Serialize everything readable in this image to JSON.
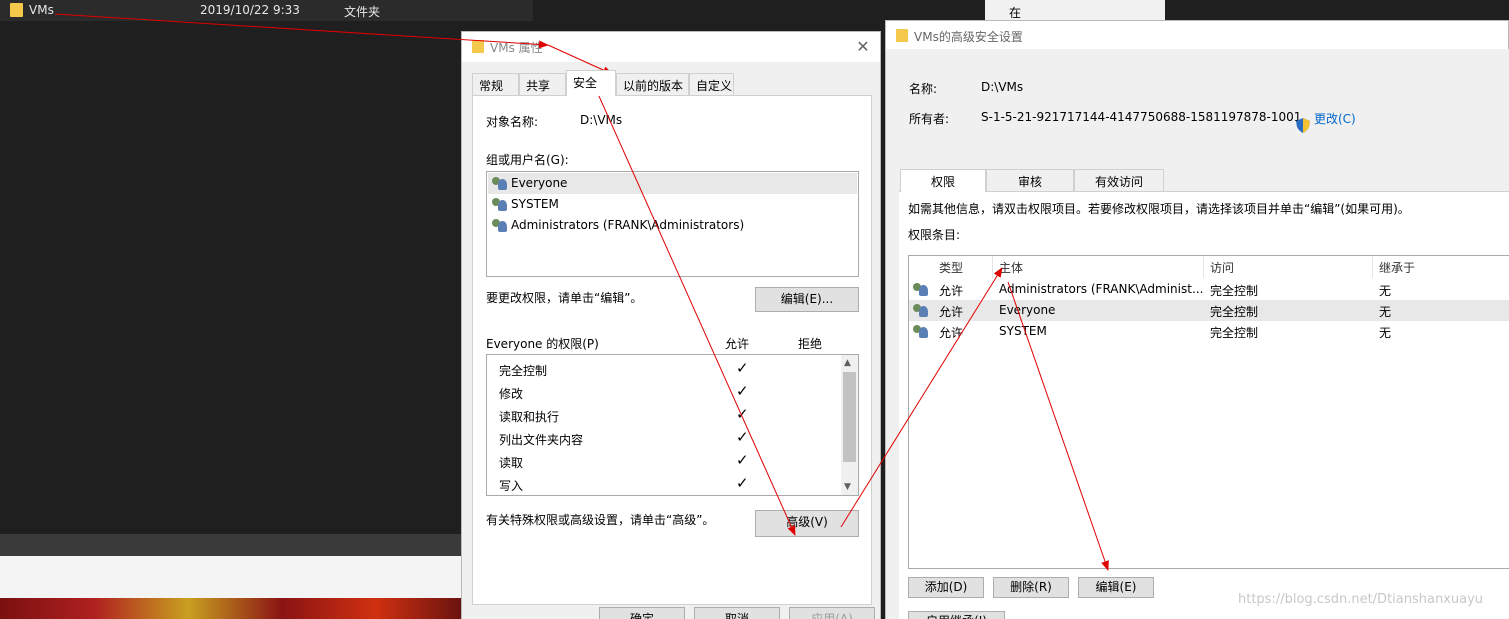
{
  "explorer": {
    "file_name": "VMs",
    "file_date": "2019/10/22 9:33",
    "file_type": "文件夹",
    "right_fragment": "在"
  },
  "properties_dialog": {
    "title": "VMs 属性",
    "tabs": [
      {
        "label": "常规"
      },
      {
        "label": "共享"
      },
      {
        "label": "安全"
      },
      {
        "label": "以前的版本"
      },
      {
        "label": "自定义"
      }
    ],
    "object_name_label": "对象名称:",
    "object_name_value": "D:\\VMs",
    "group_label": "组或用户名(G):",
    "users": [
      {
        "name": "Everyone",
        "selected": true
      },
      {
        "name": "SYSTEM",
        "selected": false
      },
      {
        "name": "Administrators (FRANK\\Administrators)",
        "selected": false
      }
    ],
    "edit_hint": "要更改权限，请单击“编辑”。",
    "edit_button": "编辑(E)...",
    "perm_label": "Everyone 的权限(P)",
    "allow_header": "允许",
    "deny_header": "拒绝",
    "permissions": [
      {
        "name": "完全控制",
        "allow": "✓"
      },
      {
        "name": "修改",
        "allow": "✓"
      },
      {
        "name": "读取和执行",
        "allow": "✓"
      },
      {
        "name": "列出文件夹内容",
        "allow": "✓"
      },
      {
        "name": "读取",
        "allow": "✓"
      },
      {
        "name": "写入",
        "allow": "✓"
      }
    ],
    "advanced_hint": "有关特殊权限或高级设置，请单击“高级”。",
    "advanced_button": "高级(V)",
    "ok_button": "确定",
    "cancel_button": "取消",
    "apply_button": "应用(A)"
  },
  "advanced_dialog": {
    "title": "VMs的高级安全设置",
    "name_label": "名称:",
    "name_value": "D:\\VMs",
    "owner_label": "所有者:",
    "owner_value": "S-1-5-21-921717144-4147750688-1581197878-1001",
    "change_link": "更改(C)",
    "tabs": [
      {
        "label": "权限"
      },
      {
        "label": "审核"
      },
      {
        "label": "有效访问"
      }
    ],
    "info_text": "如需其他信息，请双击权限项目。若要修改权限项目，请选择该项目并单击“编辑”(如果可用)。",
    "entries_label": "权限条目:",
    "columns": [
      "类型",
      "主体",
      "访问",
      "继承于"
    ],
    "rows": [
      {
        "type": "允许",
        "principal": "Administrators (FRANK\\Administ...",
        "access": "完全控制",
        "inherited": "无",
        "selected": false
      },
      {
        "type": "允许",
        "principal": "Everyone",
        "access": "完全控制",
        "inherited": "无",
        "selected": true
      },
      {
        "type": "允许",
        "principal": "SYSTEM",
        "access": "完全控制",
        "inherited": "无",
        "selected": false
      }
    ],
    "add_button": "添加(D)",
    "remove_button": "删除(R)",
    "edit_button": "编辑(E)",
    "inherit_button": "启用继承(I)"
  },
  "watermark": "https://blog.csdn.net/Dtianshanxuayu",
  "colors": {
    "folder": "#f3c84b",
    "annotation_arrow": "#e00000",
    "link": "#0066cc",
    "selection": "#e8e8e8"
  }
}
